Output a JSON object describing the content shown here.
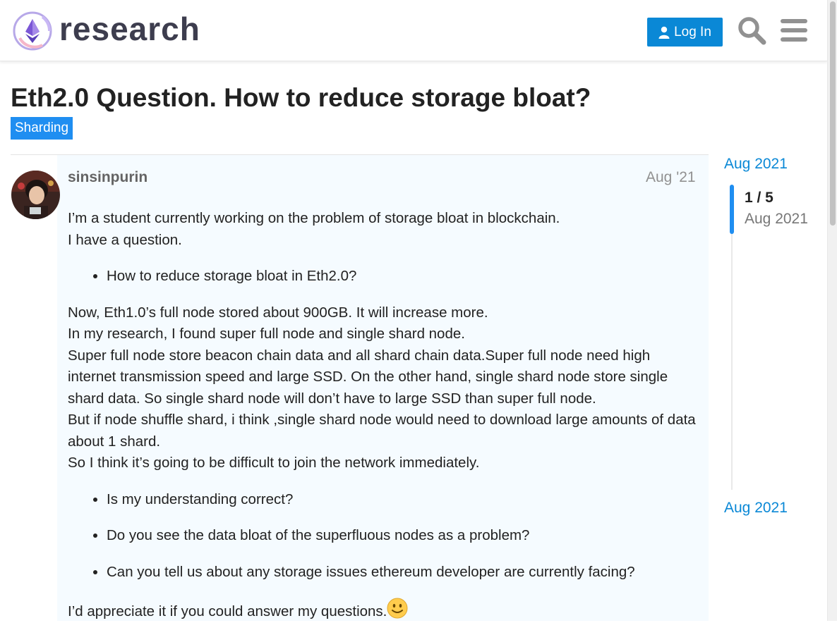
{
  "header": {
    "logo_text": "research",
    "login_label": "Log In",
    "icons": [
      "ethereum-logo-icon",
      "user-icon",
      "search-icon",
      "hamburger-menu-icon"
    ]
  },
  "topic": {
    "title": "Eth2.0 Question. How to reduce storage bloat?",
    "category": "Sharding",
    "category_color": "#1f8ef1"
  },
  "post": {
    "username": "sinsinpurin",
    "date": "Aug '21",
    "p1": [
      "I’m a student currently working on the problem of storage bloat in blockchain.",
      "I have a question."
    ],
    "list1": [
      "How to reduce storage bloat in Eth2.0?"
    ],
    "p2": [
      "Now, Eth1.0’s full node stored about 900GB. It will increase more.",
      "In my research, I found super full node and single shard node.",
      "Super full node store beacon chain data and all shard chain data.Super full node need high internet transmission speed and large SSD. On the other hand, single shard node store single shard data. So single shard node will don’t have to large SSD than super full node.",
      "But if node shuffle shard, i think ,single shard node would need to download large amounts of data about 1 shard.",
      "So I think it’s going to be difficult to join the network immediately."
    ],
    "list2": [
      "Is my understanding correct?",
      "Do you see the data bloat of the superfluous nodes as a problem?",
      "Can you tell us about any storage issues ethereum developer are currently facing?"
    ],
    "p3": "I’d appreciate it if you could answer my questions."
  },
  "timeline": {
    "top_date": "Aug 2021",
    "counter": "1 / 5",
    "counter_date": "Aug 2021",
    "bottom_date": "Aug 2021"
  },
  "colors": {
    "accent": "#0a88d6",
    "post_background": "#f5fbff"
  }
}
